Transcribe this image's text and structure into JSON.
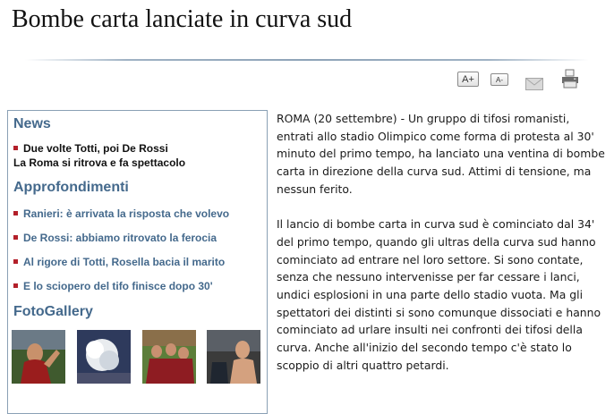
{
  "article": {
    "title": "Bombe carta lanciate in curva sud",
    "paragraphs": [
      "ROMA (20 settembre) - Un gruppo di tifosi romanisti, entrati allo stadio Olimpico come forma di protesta al 30' minuto del primo tempo, ha lanciato una ventina di bombe carta in direzione della curva sud. Attimi di tensione, ma nessun ferito.",
      "Il lancio di bombe carta in curva sud è cominciato dal 34' del primo tempo, quando gli ultras della curva sud hanno cominciato ad entrare nel loro settore. Si sono contate, senza che nessuno intervenisse per far cessare i lanci, undici esplosioni in una parte dello stadio vuota. Ma gli spettatori dei distinti si sono comunque dissociati e hanno cominciato ad urlare insulti nei confronti dei tifosi della curva. Anche all'inizio del secondo tempo c'è stato lo scoppio di altri quattro petardi."
    ]
  },
  "tools": {
    "font_increase": "A+",
    "font_decrease": "A-",
    "mail_icon": "envelope-icon",
    "print_icon": "printer-icon"
  },
  "sidebar": {
    "news_title": "News",
    "news_item_line1": "Due volte Totti, poi De Rossi",
    "news_item_line2": "La Roma si ritrova e fa spettacolo",
    "approfondimenti_title": "Approfondimenti",
    "links": [
      "Ranieri: è arrivata la risposta che volevo",
      "De Rossi: abbiamo ritrovato la ferocia",
      "Al rigore di Totti, Rosella bacia il marito",
      "E lo sciopero del tifo finisce dopo 30'"
    ],
    "gallery_title": "FotoGallery"
  },
  "colors": {
    "accent_blue": "#44698c",
    "bullet_red": "#b3202a",
    "sidebar_border": "#8aa0b5"
  }
}
